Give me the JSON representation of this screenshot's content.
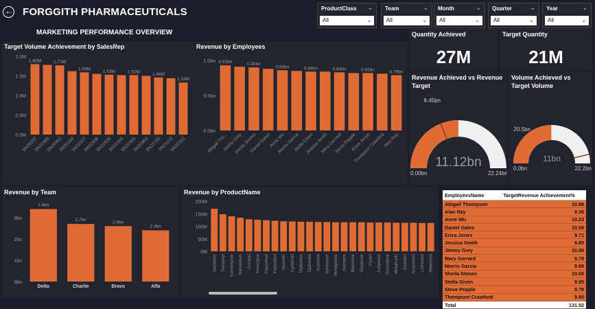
{
  "header": {
    "title": "FORGGITH PHARMACEUTICALS",
    "subtitle": "MARKETING PERFORMANCE OVERVIEW",
    "back_icon": "back-arrow-icon"
  },
  "filters": [
    {
      "label": "ProductClass",
      "value": "All"
    },
    {
      "label": "Team",
      "value": "All"
    },
    {
      "label": "Month",
      "value": "All"
    },
    {
      "label": "Quarter",
      "value": "All"
    },
    {
      "label": "Year",
      "value": "All"
    }
  ],
  "kpis": {
    "quantity_achieved": {
      "label": "Quantity Achieved",
      "value": "27M"
    },
    "target_quantity": {
      "label": "Target Quantity",
      "value": "21M"
    }
  },
  "colors": {
    "bar": "#e06b35",
    "gauge_track": "#f0f0f0",
    "background": "#1b1d2b",
    "panel": "#22242f"
  },
  "chart_data": [
    {
      "id": "target_volume_by_salesrep",
      "type": "bar",
      "title": "Target Volume Achievement by SalesRep",
      "categories": [
        "SN23397",
        "SN22998",
        "SN20463",
        "SN20168",
        "SN22627",
        "SN22996",
        "SN22026",
        "SN21505",
        "SN22045",
        "SN20964",
        "SN21730",
        "SN21119",
        "SN22310"
      ],
      "values": [
        1.8,
        1.78,
        1.77,
        1.62,
        1.59,
        1.55,
        1.53,
        1.52,
        1.52,
        1.5,
        1.46,
        1.44,
        1.33
      ],
      "data_labels": [
        "1.80M",
        "",
        "1.77M",
        "",
        "1.59M",
        "",
        "1.53M",
        "",
        "1.52M",
        "",
        "1.46M",
        "",
        "1.33M"
      ],
      "y_ticks": [
        "0.0M",
        "0.5M",
        "1.0M",
        "1.5M",
        "2.0M"
      ],
      "ylim": [
        0,
        2.0
      ]
    },
    {
      "id": "revenue_by_employees",
      "type": "bar",
      "title": "Revenue by Employees",
      "categories": [
        "Abigail Tho...",
        "Jimmy Grey",
        "Sheila Stones",
        "Daniel Gates",
        "Anne Wu",
        "Morris Garcia",
        "Stella Given",
        "Jessica Smith",
        "Mary Gerrard",
        "Steve Pepple",
        "Erica Jones",
        "Thompson Crawford",
        "Alan Ray"
      ],
      "values": [
        0.93,
        0.91,
        0.9,
        0.88,
        0.86,
        0.85,
        0.84,
        0.84,
        0.83,
        0.82,
        0.82,
        0.81,
        0.79
      ],
      "data_labels": [
        "0.93bn",
        "",
        "0.90bn",
        "",
        "0.86bn",
        "",
        "0.84bn",
        "",
        "0.83bn",
        "",
        "0.82bn",
        "",
        "0.79bn"
      ],
      "y_ticks": [
        "0.0bn",
        "0.5bn",
        "1.0bn"
      ],
      "ylim": [
        0,
        1.0
      ]
    },
    {
      "id": "revenue_gauge",
      "type": "gauge",
      "title": "Revenue Achieved vs Revenue Target",
      "value": 11.12,
      "value_label": "11.12bn",
      "target": 8.45,
      "target_label": "8.45bn",
      "min_label": "0.00bn",
      "max": 22.24,
      "max_label": "22.24bn"
    },
    {
      "id": "volume_gauge",
      "type": "gauge",
      "title": "Volume Achieved vs Target Volume",
      "value": 11,
      "value_label": "11bn",
      "target": 20.5,
      "target_label": "20.5bn",
      "min_label": "0.0bn",
      "max": 22.2,
      "max_label": "22.2bn"
    },
    {
      "id": "revenue_by_team",
      "type": "bar",
      "title": "Revenue by Team",
      "categories": [
        "Delta",
        "Charlie",
        "Bravo",
        "Alfa"
      ],
      "values": [
        3.4,
        2.7,
        2.6,
        2.4
      ],
      "data_labels": [
        "3.4bn",
        "2.7bn",
        "2.6bn",
        "2.4bn"
      ],
      "y_ticks": [
        "0bn",
        "1bn",
        "2bn",
        "3bn"
      ],
      "ylim": [
        0,
        3.8
      ]
    },
    {
      "id": "revenue_by_productname",
      "type": "bar",
      "title": "Revenue by ProductName",
      "categories": [
        "Ionclotide",
        "Tetratonyl",
        "Sumanazole",
        "Bancenium",
        "Docstrel",
        "Trivocizine",
        "Papoxitran",
        "Kadardacil",
        "Nexandil",
        "Cyclofodil",
        "Diphosfan",
        "Taptistatin",
        "Acycortin",
        "Symbocort",
        "Mornignone",
        "Antiainon",
        "Maxtorine",
        "Oxyduran",
        "Fizavil",
        "Antipercin",
        "Trizoxalone",
        "Morphizolil",
        "Ananidol",
        "Amaxistatil",
        "Lomoviral",
        "Abbrevital"
      ],
      "values": [
        170,
        148,
        140,
        134,
        128,
        126,
        124,
        122,
        120,
        119,
        118,
        118,
        117,
        117,
        116,
        116,
        116,
        116,
        115,
        115,
        115,
        114,
        114,
        114,
        113,
        113
      ],
      "y_ticks": [
        "0M",
        "50M",
        "100M",
        "150M",
        "200M"
      ],
      "ylim": [
        0,
        200
      ]
    }
  ],
  "employee_table": {
    "headers": [
      "EmployeesName",
      "TargetRevenue Achievement%"
    ],
    "rows": [
      [
        "Abigail Thompson",
        "10.99"
      ],
      [
        "Alan Ray",
        "9.36"
      ],
      [
        "Anne Wu",
        "10.23"
      ],
      [
        "Daniel Gates",
        "10.59"
      ],
      [
        "Erica Jones",
        "9.71"
      ],
      [
        "Jessica Smith",
        "9.85"
      ],
      [
        "Jimmy Grey",
        "10.99"
      ],
      [
        "Mary Gerrard",
        "9.79"
      ],
      [
        "Morris Garcia",
        "9.99"
      ],
      [
        "Sheila Stones",
        "10.69"
      ],
      [
        "Stella Given",
        "9.95"
      ],
      [
        "Steve Pepple",
        "9.78"
      ],
      [
        "Thompson Crawford",
        "9.60"
      ]
    ],
    "total": [
      "Total",
      "131.52"
    ]
  }
}
